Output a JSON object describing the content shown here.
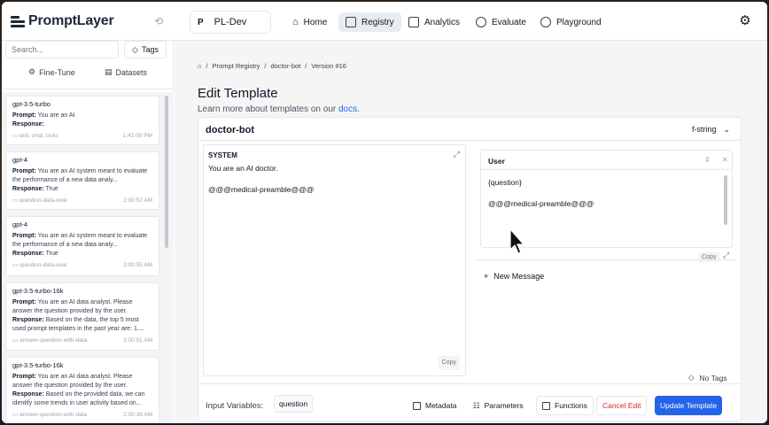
{
  "header": {
    "logo_text": "PromptLayer",
    "workspace_letter": "P",
    "workspace_name": "PL-Dev",
    "nav": [
      {
        "label": "Home",
        "icon": "home-icon",
        "active": false
      },
      {
        "label": "Registry",
        "icon": "folder-icon",
        "active": true
      },
      {
        "label": "Analytics",
        "icon": "chart-icon",
        "active": false
      },
      {
        "label": "Evaluate",
        "icon": "question-circle-icon",
        "active": false
      },
      {
        "label": "Playground",
        "icon": "play-circle-icon",
        "active": false
      }
    ]
  },
  "sidebar": {
    "search_placeholder": "Search...",
    "tags_label": "Tags",
    "tabs": [
      {
        "label": "Fine-Tune",
        "icon": "fine-tune-icon"
      },
      {
        "label": "Datasets",
        "icon": "dataset-icon"
      }
    ],
    "requests": [
      {
        "model": "gpt-3.5-turbo",
        "prompt": "You are an AI",
        "response": "",
        "tag": "test, chat, tools",
        "time": "1:41:00 PM"
      },
      {
        "model": "gpt-4",
        "prompt": "You are an AI system meant to evaluate the performance of a new data analy...",
        "response": "True",
        "tag": "question-data-eval",
        "time": "2:00:57 AM"
      },
      {
        "model": "gpt-4",
        "prompt": "You are an AI system meant to evaluate the performance of a new data analy...",
        "response": "True",
        "tag": "question-data-eval",
        "time": "2:00:55 AM"
      },
      {
        "model": "gpt-3.5-turbo-16k",
        "prompt": "You are an AI data analyst. Please answer the question provided by the user.",
        "response": "Based on the data, the top 5 most used prompt templates in the past year are: 1....",
        "tag": "answer-question-with-data",
        "time": "2:00:51 AM"
      },
      {
        "model": "gpt-3.5-turbo-16k",
        "prompt": "You are an AI data analyst. Please answer the question provided by the user.",
        "response": "Based on the provided data, we can identify some trends in user activity based on...",
        "tag": "answer-question-with-data",
        "time": "2:00:39 AM"
      }
    ],
    "labels": {
      "prompt": "Prompt:",
      "response": "Response:"
    }
  },
  "main": {
    "breadcrumb": [
      "Prompt Registry",
      "doctor-bot",
      "Version #16"
    ],
    "title": "Edit Template",
    "subtitle_prefix": "Learn more about templates on our ",
    "subtitle_link": "docs",
    "subtitle_suffix": ".",
    "template_name": "doctor-bot",
    "format": "f-string",
    "system": {
      "role": "SYSTEM",
      "line1": "You are an AI doctor.",
      "line2": "@@@medical-preamble@@@",
      "copy": "Copy"
    },
    "user": {
      "role": "User",
      "line1": "{question}",
      "line2": "@@@medical-preamble@@@",
      "copy": "Copy"
    },
    "new_message": "New Message",
    "no_tags": "No Tags",
    "input_variables_label": "Input Variables:",
    "input_variables": [
      "question"
    ],
    "buttons": {
      "metadata": "Metadata",
      "parameters": "Parameters",
      "functions": "Functions",
      "cancel": "Cancel Edit",
      "update": "Update Template"
    }
  },
  "colors": {
    "accent": "#2563eb",
    "cancel": "#dc2626"
  }
}
